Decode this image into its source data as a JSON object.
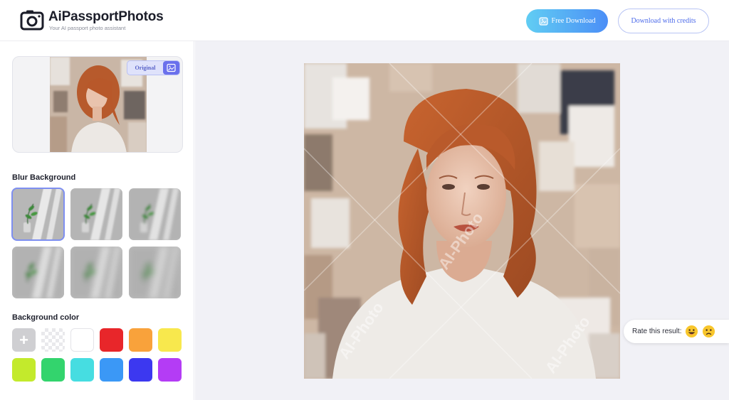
{
  "header": {
    "brand": "AiPassportPhotos",
    "tagline": "Your AI passport photo assistant",
    "free_download_label": "Free Download",
    "credits_label": "Download with credits"
  },
  "sidebar": {
    "preview": {
      "toggle_label": "Original"
    },
    "blur_section_title": "Blur Background",
    "blur_options": [
      {
        "level": 1,
        "selected": true
      },
      {
        "level": 2,
        "selected": false
      },
      {
        "level": 3,
        "selected": false
      },
      {
        "level": 4,
        "selected": false
      },
      {
        "level": 5,
        "selected": false
      },
      {
        "level": 6,
        "selected": false
      }
    ],
    "color_section_title": "Background color",
    "colors": [
      "add",
      "transparent",
      "#ffffff",
      "#e8262a",
      "#f9a23b",
      "#f8e84d",
      "#c3ea2c",
      "#33d46d",
      "#46dde1",
      "#3b98f6",
      "#3c38f0",
      "#b43cf5"
    ]
  },
  "main": {
    "watermark": "AI-Photo",
    "rate_label": "Rate this result:",
    "rate_icons": [
      "happy-emoji-icon",
      "sad-emoji-icon"
    ]
  },
  "colors": {
    "accent": "#4b8ef6",
    "accent_light": "#61cdf3",
    "credits_text": "#4d6bea",
    "toggle_bg": "#dfe2fb"
  }
}
